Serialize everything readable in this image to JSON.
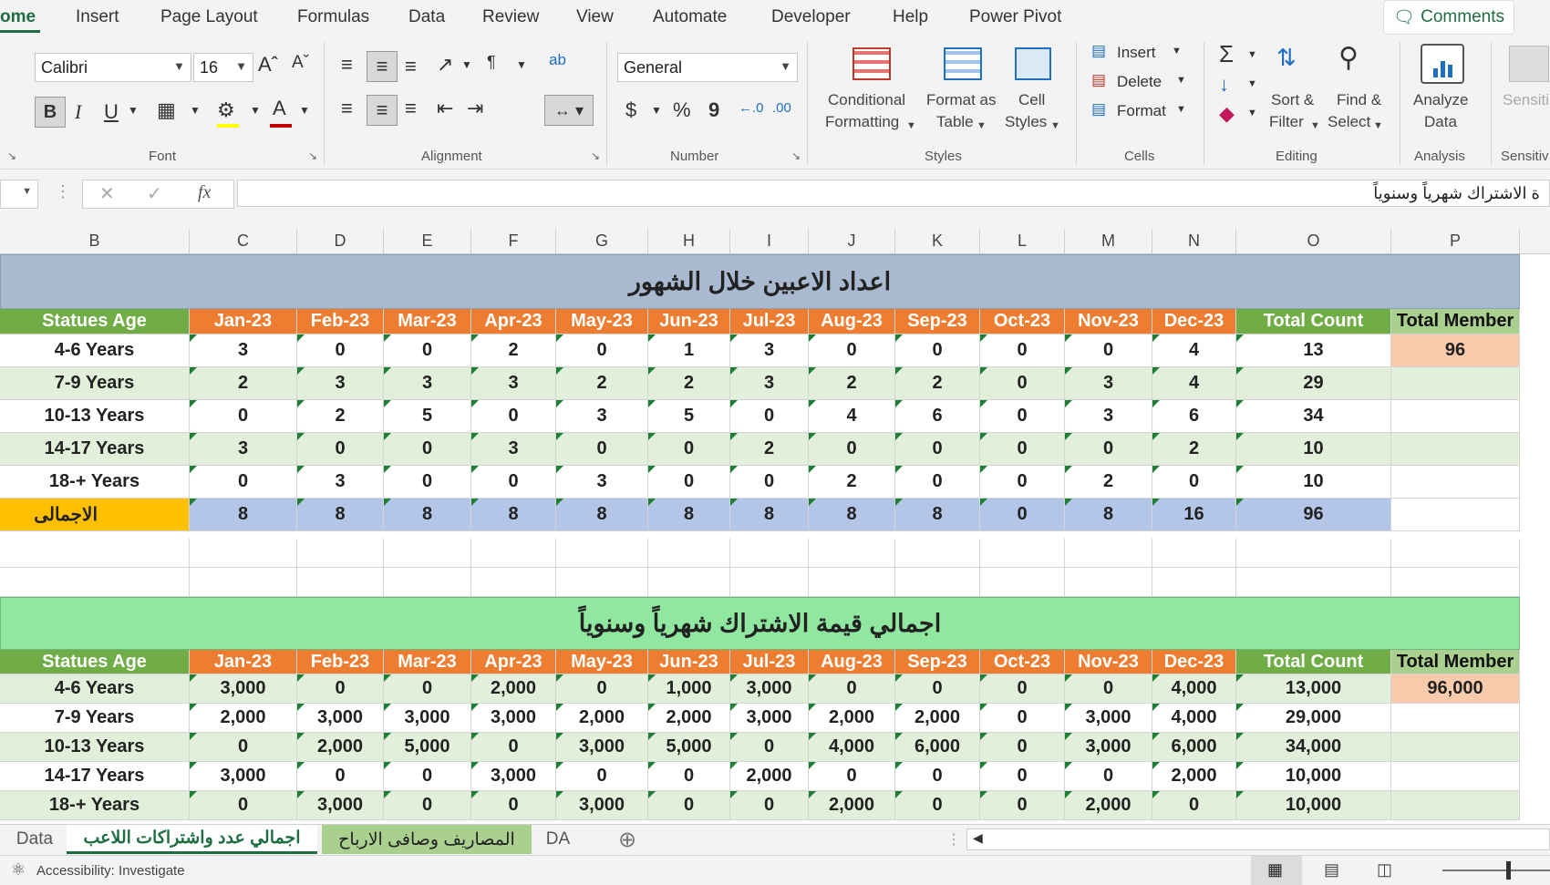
{
  "menu": {
    "tabs": [
      "ome",
      "Insert",
      "Page Layout",
      "Formulas",
      "Data",
      "Review",
      "View",
      "Automate",
      "Developer",
      "Help",
      "Power Pivot"
    ],
    "comments": "Comments"
  },
  "ribbon": {
    "font_name": "Calibri",
    "font_size": "16",
    "number_format": "General",
    "groups": {
      "font": "Font",
      "alignment": "Alignment",
      "number": "Number",
      "styles": "Styles",
      "cells": "Cells",
      "editing": "Editing",
      "analysis": "Analysis",
      "sensitivity": "Sensitiv"
    },
    "conditional_formatting": [
      "Conditional",
      "Formatting"
    ],
    "format_as_table": [
      "Format as",
      "Table"
    ],
    "cell_styles": [
      "Cell",
      "Styles"
    ],
    "insert": "Insert",
    "delete": "Delete",
    "format": "Format",
    "sort_filter": [
      "Sort &",
      "Filter"
    ],
    "find_select": [
      "Find &",
      "Select"
    ],
    "analyze_data": [
      "Analyze",
      "Data"
    ],
    "sensitivity": "Sensiti",
    "bold": "B",
    "italic": "I",
    "underline": "U",
    "currency": "$",
    "percent": "%",
    "comma": "9",
    "inc_dec": "←.0 .00",
    "dec_dec": ".00 →.0"
  },
  "formula_bar": {
    "content": "ة الاشتراك شهرياً وسنوياً",
    "fx": "fx"
  },
  "columns": [
    "B",
    "C",
    "D",
    "E",
    "F",
    "G",
    "H",
    "I",
    "J",
    "K",
    "L",
    "M",
    "N",
    "O",
    "P"
  ],
  "table1": {
    "title": "اعداد الاعبين خلال الشهور",
    "headers": [
      "Statues Age",
      "Jan-23",
      "Feb-23",
      "Mar-23",
      "Apr-23",
      "May-23",
      "Jun-23",
      "Jul-23",
      "Aug-23",
      "Sep-23",
      "Oct-23",
      "Nov-23",
      "Dec-23",
      "Total Count",
      "Total Member"
    ],
    "rows": [
      [
        "4-6 Years",
        "3",
        "0",
        "0",
        "2",
        "0",
        "1",
        "3",
        "0",
        "0",
        "0",
        "0",
        "4",
        "13",
        "96"
      ],
      [
        "7-9 Years",
        "2",
        "3",
        "3",
        "3",
        "2",
        "2",
        "3",
        "2",
        "2",
        "0",
        "3",
        "4",
        "29",
        ""
      ],
      [
        "10-13 Years",
        "0",
        "2",
        "5",
        "0",
        "3",
        "5",
        "0",
        "4",
        "6",
        "0",
        "3",
        "6",
        "34",
        ""
      ],
      [
        "14-17 Years",
        "3",
        "0",
        "0",
        "3",
        "0",
        "0",
        "2",
        "0",
        "0",
        "0",
        "0",
        "2",
        "10",
        ""
      ],
      [
        "18-+ Years",
        "0",
        "3",
        "0",
        "0",
        "3",
        "0",
        "0",
        "2",
        "0",
        "0",
        "2",
        "0",
        "10",
        ""
      ]
    ],
    "total_row": [
      "الاجمالى",
      "8",
      "8",
      "8",
      "8",
      "8",
      "8",
      "8",
      "8",
      "8",
      "0",
      "8",
      "16",
      "96",
      ""
    ]
  },
  "table2": {
    "title": "اجمالي قيمة الاشتراك شهرياً وسنوياً",
    "headers": [
      "Statues Age",
      "Jan-23",
      "Feb-23",
      "Mar-23",
      "Apr-23",
      "May-23",
      "Jun-23",
      "Jul-23",
      "Aug-23",
      "Sep-23",
      "Oct-23",
      "Nov-23",
      "Dec-23",
      "Total Count",
      "Total Member"
    ],
    "rows": [
      [
        "4-6 Years",
        "3,000",
        "0",
        "0",
        "2,000",
        "0",
        "1,000",
        "3,000",
        "0",
        "0",
        "0",
        "0",
        "4,000",
        "13,000",
        "96,000"
      ],
      [
        "7-9 Years",
        "2,000",
        "3,000",
        "3,000",
        "3,000",
        "2,000",
        "2,000",
        "3,000",
        "2,000",
        "2,000",
        "0",
        "3,000",
        "4,000",
        "29,000",
        ""
      ],
      [
        "10-13 Years",
        "0",
        "2,000",
        "5,000",
        "0",
        "3,000",
        "5,000",
        "0",
        "4,000",
        "6,000",
        "0",
        "3,000",
        "6,000",
        "34,000",
        ""
      ],
      [
        "14-17 Years",
        "3,000",
        "0",
        "0",
        "3,000",
        "0",
        "0",
        "2,000",
        "0",
        "0",
        "0",
        "0",
        "2,000",
        "10,000",
        ""
      ],
      [
        "18-+ Years",
        "0",
        "3,000",
        "0",
        "0",
        "3,000",
        "0",
        "0",
        "2,000",
        "0",
        "0",
        "2,000",
        "0",
        "10,000",
        ""
      ]
    ]
  },
  "sheet_tabs": [
    "Data",
    "اجمالي عدد واشتراكات اللاعب",
    "المصاريف وصافى الارباح",
    "DA"
  ],
  "status": {
    "accessibility": "Accessibility: Investigate"
  },
  "colors": {
    "accent": "#1e6e42",
    "header_green": "#70ad47",
    "header_orange": "#ed7d31",
    "total_blue": "#b4c6e7",
    "total_yellow": "#ffc000",
    "banner1": "#a9b9cf",
    "banner2": "#90e8a0"
  }
}
